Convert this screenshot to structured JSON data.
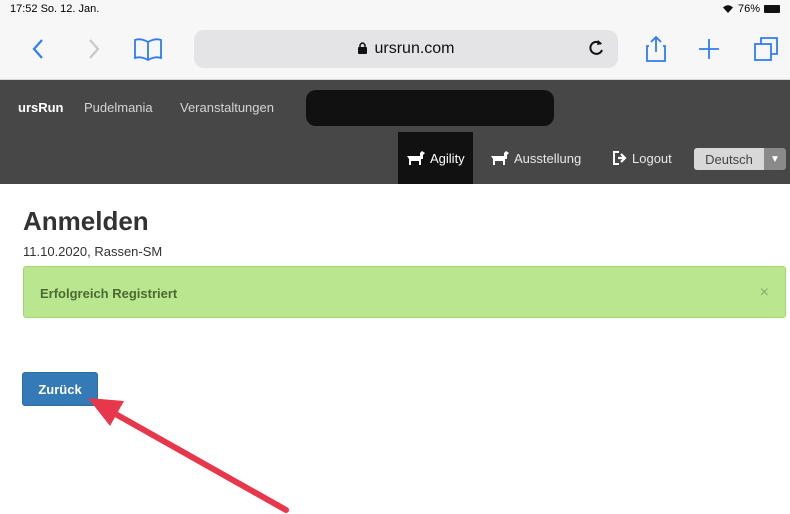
{
  "status_bar": {
    "time": "17:52",
    "date": "So. 12. Jan.",
    "battery": "76%"
  },
  "browser": {
    "url": "ursrun.com"
  },
  "navbar": {
    "brand": "ursRun",
    "links": [
      "Pudelmania",
      "Veranstaltungen"
    ],
    "agility": "Agility",
    "ausstellung": "Ausstellung",
    "logout": "Logout",
    "language": "Deutsch"
  },
  "main": {
    "title": "Anmelden",
    "subtitle": "11.10.2020, Rassen-SM",
    "alert_message": "Erfolgreich Registriert",
    "alert_close": "×",
    "back_button": "Zurück"
  },
  "colors": {
    "navbar_bg": "#474747",
    "alert_bg": "#b9e68f",
    "button_bg": "#337ab7",
    "arrow": "#e8364a"
  }
}
